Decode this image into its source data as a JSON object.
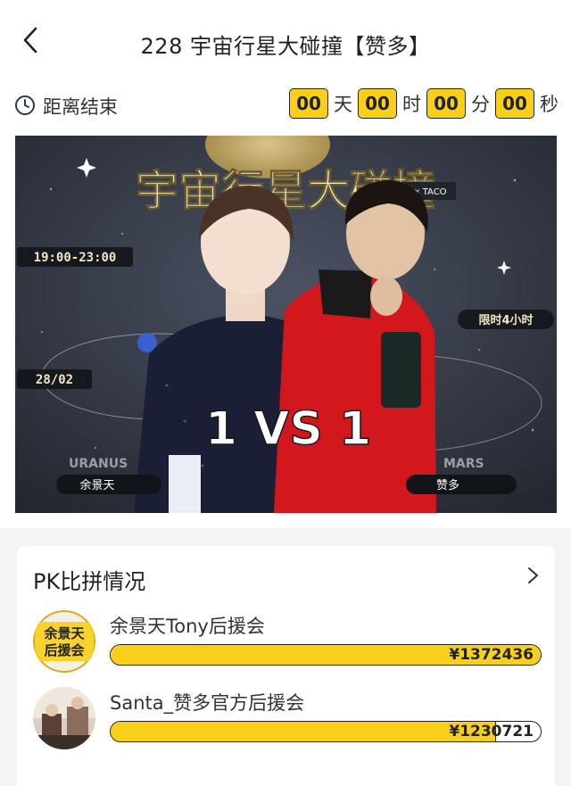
{
  "header": {
    "title": "228 宇宙行星大碰撞【赞多】",
    "back_icon": "chevron-left-icon"
  },
  "countdown": {
    "label": "距离结束",
    "icon": "clock-icon",
    "days": "00",
    "day_unit": "天",
    "hours": "00",
    "hour_unit": "时",
    "minutes": "00",
    "minute_unit": "分",
    "seconds": "00",
    "second_unit": "秒",
    "box_color": "#f9cf19"
  },
  "banner": {
    "headline": "宇宙行星大碰撞",
    "sponsor_tag": "粉撕 x TACO",
    "time_range": "19:00-23:00",
    "date": "28/02",
    "time_limit": "限时4小时",
    "vs_text": "1 VS 1",
    "left_planet": "URANUS",
    "right_planet": "MARS",
    "left_name": "余景天",
    "right_name": "赞多"
  },
  "pk": {
    "title": "PK比拼情况",
    "more_icon": "chevron-right-icon",
    "entries": [
      {
        "name": "余景天Tony后援会",
        "avatar_text_line1": "余景天",
        "avatar_text_line2": "后援会",
        "amount": "¥1372436",
        "progress": 1.0
      },
      {
        "name": "Santa_赞多官方后援会",
        "amount": "¥1230721",
        "progress": 0.896
      }
    ]
  }
}
